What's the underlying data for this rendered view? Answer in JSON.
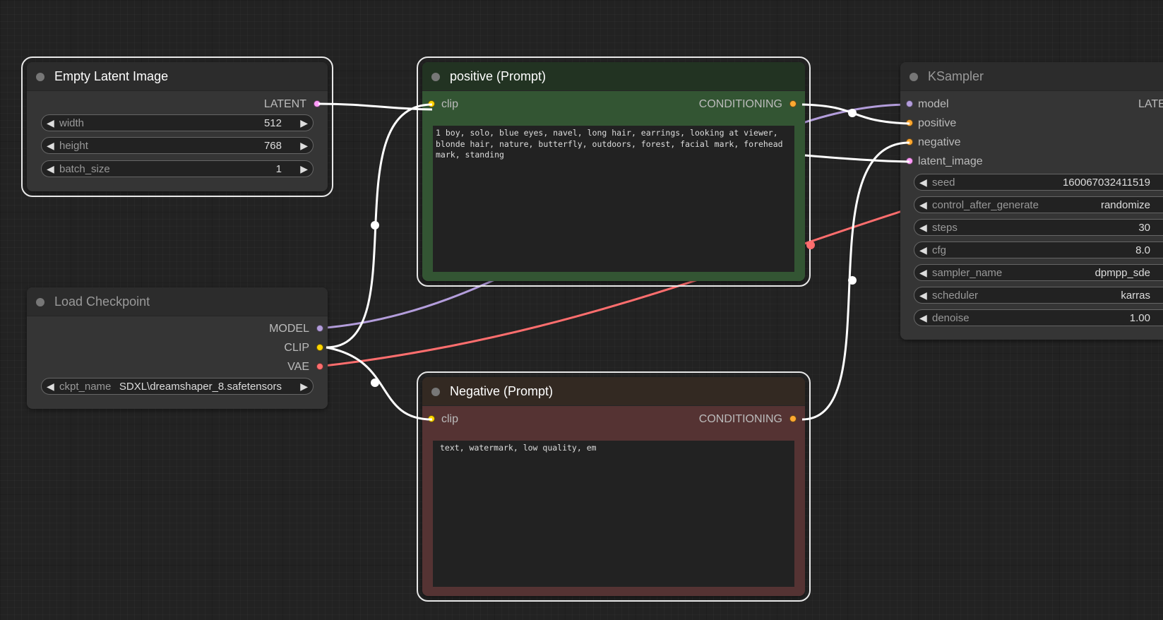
{
  "colors": {
    "background": "#222222",
    "link_latent": "#ff9cf9",
    "link_clip": "#ffd500",
    "link_model": "#b39ddb",
    "link_vae": "#ff6e6e",
    "link_conditioning": "#ffa931",
    "positive_node_body": "#335533",
    "positive_node_title": "#223322",
    "negative_node_body": "#553333",
    "negative_node_title": "#332922"
  },
  "nodes": {
    "empty_latent": {
      "title": "Empty Latent Image",
      "output_latent": "LATENT",
      "widgets": {
        "width": {
          "name": "width",
          "value": "512"
        },
        "height": {
          "name": "height",
          "value": "768"
        },
        "batch_size": {
          "name": "batch_size",
          "value": "1"
        }
      }
    },
    "load_checkpoint": {
      "title": "Load Checkpoint",
      "output_model": "MODEL",
      "output_clip": "CLIP",
      "output_vae": "VAE",
      "ckpt_name": {
        "name": "ckpt_name",
        "value": "SDXL\\dreamshaper_8.safetensors"
      }
    },
    "positive": {
      "title": "positive (Prompt)",
      "input_clip": "clip",
      "output_conditioning": "CONDITIONING",
      "text": "1 boy, solo, blue eyes, navel, long hair, earrings, looking at viewer, blonde hair, nature, butterfly, outdoors, forest, facial mark, forehead mark, standing"
    },
    "negative": {
      "title": "Negative (Prompt)",
      "input_clip": "clip",
      "output_conditioning": "CONDITIONING",
      "text": "text, watermark, low quality, em"
    },
    "ksampler": {
      "title": "KSampler",
      "input_model": "model",
      "input_positive": "positive",
      "input_negative": "negative",
      "input_latent_image": "latent_image",
      "output_latent": "LATE",
      "widgets": {
        "seed": {
          "name": "seed",
          "value": "160067032411519"
        },
        "control_after_generate": {
          "name": "control_after_generate",
          "value": "randomize"
        },
        "steps": {
          "name": "steps",
          "value": "30"
        },
        "cfg": {
          "name": "cfg",
          "value": "8.0"
        },
        "sampler_name": {
          "name": "sampler_name",
          "value": "dpmpp_sde"
        },
        "scheduler": {
          "name": "scheduler",
          "value": "karras"
        },
        "denoise": {
          "name": "denoise",
          "value": "1.00"
        }
      }
    }
  }
}
